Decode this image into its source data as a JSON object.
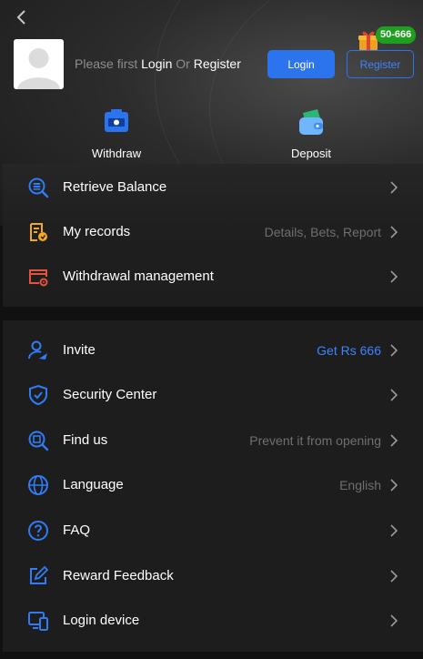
{
  "colors": {
    "accent": "#2c73ee",
    "accent_text": "#3b84ff",
    "icon_blue": "#2f7cf6",
    "icon_orange": "#f5a623",
    "icon_red": "#e5533d",
    "badge_green": "#1f9f1f"
  },
  "header": {
    "prompt_prefix": "Please first",
    "prompt_login": "Login",
    "prompt_or": "Or",
    "prompt_register": "Register",
    "login_button": "Login",
    "register_button": "Register",
    "gift_badge": "50-666"
  },
  "quick_actions": [
    {
      "label": "Withdraw",
      "icon": "withdraw-icon"
    },
    {
      "label": "Deposit",
      "icon": "wallet-icon"
    }
  ],
  "menu_top": [
    {
      "label": "Retrieve Balance",
      "value": "",
      "icon": "balance-search-icon"
    },
    {
      "label": "My records",
      "value": "Details, Bets, Report",
      "icon": "records-icon"
    },
    {
      "label": "Withdrawal management",
      "value": "",
      "icon": "card-gear-icon"
    }
  ],
  "menu_bottom": [
    {
      "label": "Invite",
      "value": "Get Rs 666",
      "icon": "invite-icon"
    },
    {
      "label": "Security Center",
      "value": "",
      "icon": "shield-icon"
    },
    {
      "label": "Find us",
      "value": "Prevent it from opening",
      "icon": "find-icon"
    },
    {
      "label": "Language",
      "value": "English",
      "icon": "globe-icon"
    },
    {
      "label": "FAQ",
      "value": "",
      "icon": "question-icon"
    },
    {
      "label": "Reward Feedback",
      "value": "",
      "icon": "edit-icon"
    },
    {
      "label": "Login device",
      "value": "",
      "icon": "device-icon"
    }
  ]
}
